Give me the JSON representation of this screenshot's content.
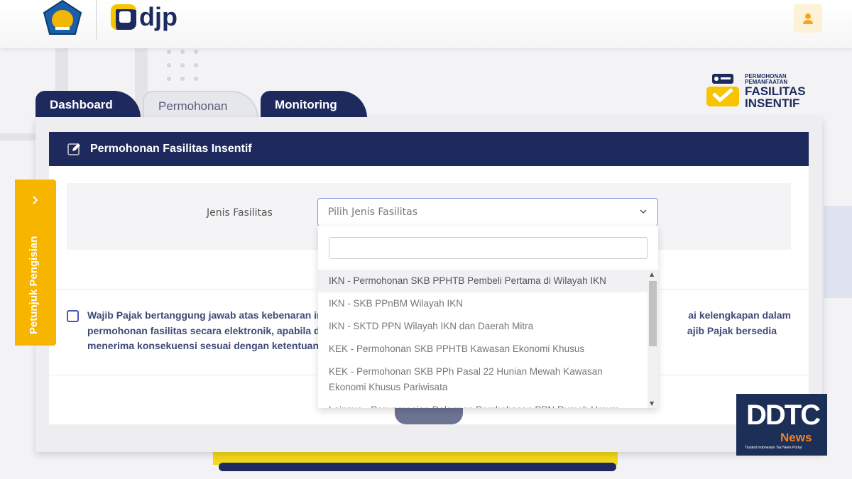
{
  "header": {
    "brand_text": "djp",
    "user_icon": "user-icon"
  },
  "brand_badge": {
    "line1": "PERMOHONAN",
    "line2": "PEMANFAATAN",
    "line3": "FASILITAS",
    "line4": "INSENTIF"
  },
  "tabs": [
    {
      "label": "Dashboard",
      "active": false
    },
    {
      "label": "Permohonan",
      "active": true
    },
    {
      "label": "Monitoring",
      "active": false
    }
  ],
  "panel": {
    "title": "Permohonan Fasilitas Insentif"
  },
  "form": {
    "jenis_label": "Jenis Fasilitas",
    "select_placeholder": "Pilih Jenis Fasilitas",
    "search_value": "",
    "options": [
      "IKN - Permohonan SKB PPHTB Pembeli Pertama di Wilayah IKN",
      "IKN - SKB PPnBM Wilayah IKN",
      "IKN - SKTD PPN Wilayah IKN dan Daerah Mitra",
      "KEK - Permohonan SKB PPHTB Kawasan Ekonomi Khusus",
      "KEK - Permohonan SKB PPh Pasal 22 Hunian Mewah Kawasan Ekonomi Khusus Pariwisata",
      "Lainnya - Penyampaian Dokumen Pembebasan PPN Rumah Umum"
    ]
  },
  "agreement": {
    "line1_left": "Wajib Pajak bertanggung jawab atas kebenaran in",
    "line1_right": "ai kelengkapan dalam",
    "line2_left": "permohonan fasilitas secara elektronik, apabila d",
    "line2_right": "ajib Pajak bersedia",
    "line3_left": "menerima konsekuensi sesuai dengan ketentuan"
  },
  "side_tab": {
    "label": "Petunjuk Pengisian"
  },
  "watermark": {
    "logo": "DDTC",
    "sub": "News",
    "tagline": "Trusted Indonesian Tax News Portal"
  },
  "colors": {
    "navy": "#1e2a5e",
    "yellow": "#f7b500",
    "accent": "#8a95d8"
  }
}
